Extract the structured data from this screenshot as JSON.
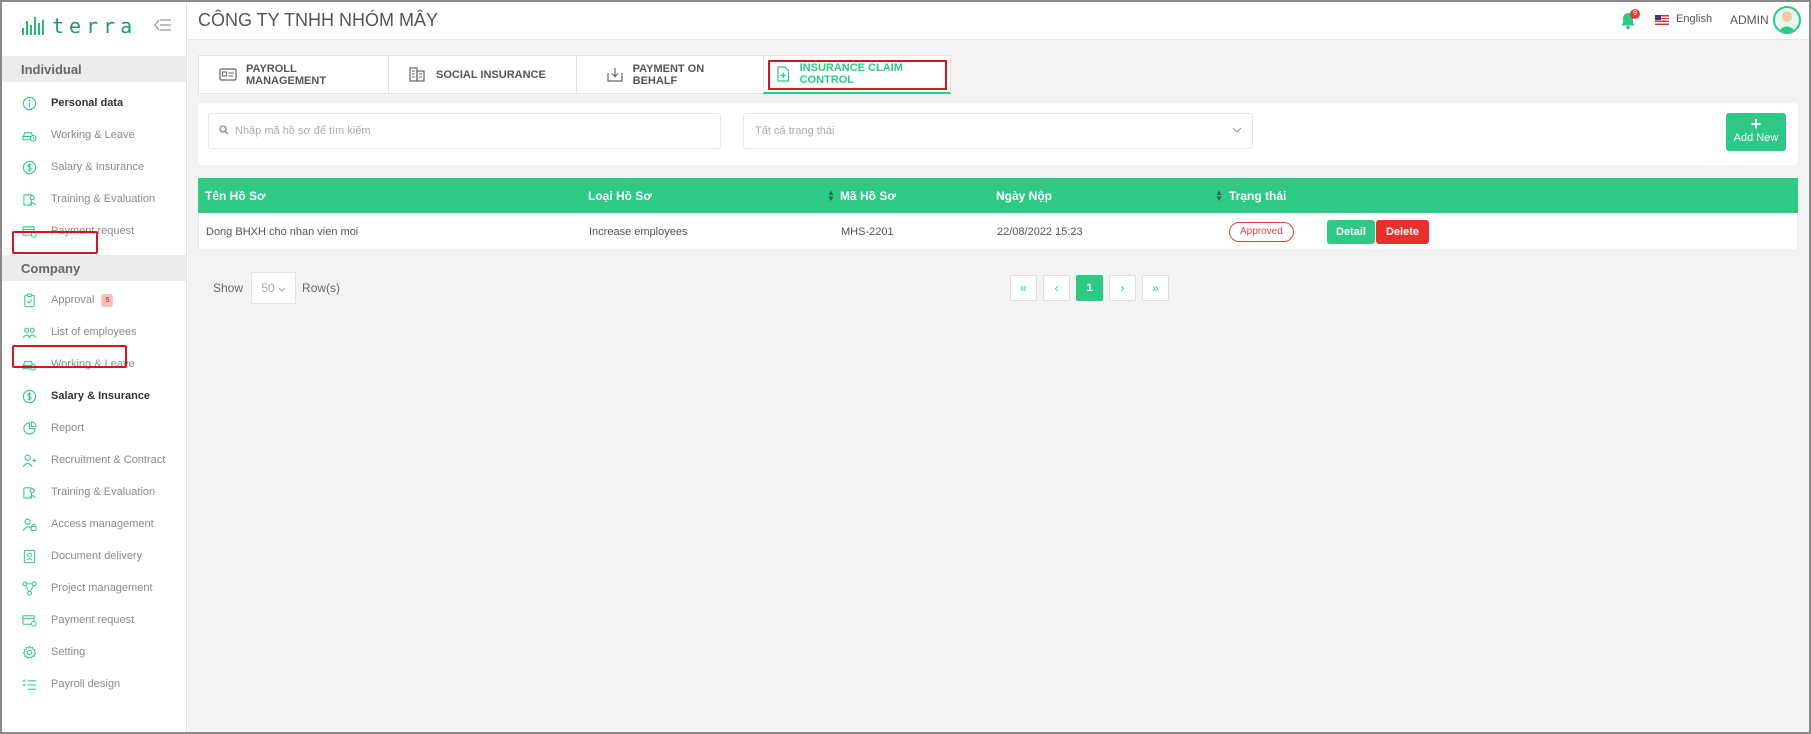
{
  "sidebar": {
    "logo_text": "terra",
    "section_individual": "Individual",
    "individual_items": [
      {
        "label": "Personal data",
        "icon": "info-icon",
        "bold": true
      },
      {
        "label": "Working & Leave",
        "icon": "car-clock-icon"
      },
      {
        "label": "Salary & Insurance",
        "icon": "dollar-icon"
      },
      {
        "label": "Training & Evaluation",
        "icon": "training-icon"
      },
      {
        "label": "Payment request",
        "icon": "card-icon"
      }
    ],
    "section_company": "Company",
    "company_items": [
      {
        "label": "Approval",
        "icon": "clipboard-icon",
        "badge": "5"
      },
      {
        "label": "List of employees",
        "icon": "users-icon"
      },
      {
        "label": "Working & Leave",
        "icon": "car-clock-icon"
      },
      {
        "label": "Salary & Insurance",
        "icon": "dollar-icon",
        "bold": true
      },
      {
        "label": "Report",
        "icon": "pie-chart-icon"
      },
      {
        "label": "Recruitment & Contract",
        "icon": "user-plus-icon"
      },
      {
        "label": "Training & Evaluation",
        "icon": "training-icon"
      },
      {
        "label": "Access management",
        "icon": "user-lock-icon"
      },
      {
        "label": "Document delivery",
        "icon": "document-icon"
      },
      {
        "label": "Project management",
        "icon": "network-icon"
      },
      {
        "label": "Payment request",
        "icon": "card-icon"
      },
      {
        "label": "Setting",
        "icon": "gear-icon"
      },
      {
        "label": "Payroll design",
        "icon": "list-icon"
      }
    ]
  },
  "header": {
    "company_name": "CÔNG TY TNHH NHÓM MÂY",
    "notification_count": "9",
    "language": "English",
    "user": "ADMIN"
  },
  "tabs": [
    {
      "label": "PAYROLL MANAGEMENT",
      "icon": "id-card-icon"
    },
    {
      "label": "SOCIAL INSURANCE",
      "icon": "building-icon"
    },
    {
      "label": "PAYMENT ON BEHALF",
      "icon": "download-box-icon"
    },
    {
      "label": "INSURANCE CLAIM CONTROL",
      "icon": "document-plus-icon",
      "active": true
    }
  ],
  "filters": {
    "search_placeholder": "Nhập mã hồ sơ để tìm kiếm",
    "status_placeholder": "Tất cả trạng thái",
    "add_new_label": "Add New"
  },
  "table": {
    "headers": [
      "Tên Hồ Sơ",
      "Loại Hồ Sơ",
      "Mã Hồ Sơ",
      "Ngày Nộp",
      "Trạng thái"
    ],
    "rows": [
      {
        "name": "Dong BHXH cho nhan vien moi",
        "type": "Increase employees",
        "code": "MHS-2201",
        "date": "22/08/2022 15:23",
        "status": "Approved",
        "detail_label": "Detail",
        "delete_label": "Delete"
      }
    ]
  },
  "pagination": {
    "show_label": "Show",
    "rows_value": "50",
    "rows_label": "Row(s)",
    "first": "«",
    "prev": "‹",
    "current": "1",
    "next": "›",
    "last": "»"
  },
  "colors": {
    "accent": "#2dc985",
    "danger": "#e5312d",
    "highlight_box": "#d6161e"
  }
}
